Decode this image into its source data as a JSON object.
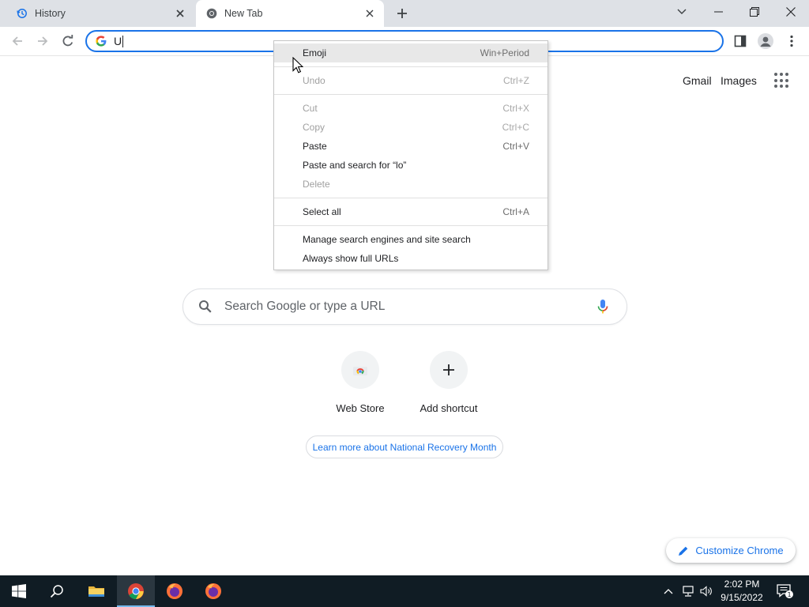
{
  "tabs": [
    {
      "title": "History",
      "icon": "history-icon"
    },
    {
      "title": "New Tab",
      "icon": "chrome-icon"
    }
  ],
  "omnibox": {
    "text": "U"
  },
  "ntp": {
    "links": {
      "gmail": "Gmail",
      "images": "Images"
    },
    "search_placeholder": "Search Google or type a URL",
    "shortcuts": [
      {
        "label": "Web Store",
        "icon": "web-store-icon"
      },
      {
        "label": "Add shortcut",
        "icon": "plus-icon"
      }
    ],
    "promo": "Learn more about National Recovery Month",
    "customize": "Customize Chrome"
  },
  "context_menu": {
    "groups": [
      [
        {
          "label": "Emoji",
          "shortcut": "Win+Period",
          "enabled": true,
          "highlighted": true
        }
      ],
      [
        {
          "label": "Undo",
          "shortcut": "Ctrl+Z",
          "enabled": false
        }
      ],
      [
        {
          "label": "Cut",
          "shortcut": "Ctrl+X",
          "enabled": false
        },
        {
          "label": "Copy",
          "shortcut": "Ctrl+C",
          "enabled": false
        },
        {
          "label": "Paste",
          "shortcut": "Ctrl+V",
          "enabled": true
        },
        {
          "label": "Paste and search for “lo”",
          "shortcut": "",
          "enabled": true
        },
        {
          "label": "Delete",
          "shortcut": "",
          "enabled": false
        }
      ],
      [
        {
          "label": "Select all",
          "shortcut": "Ctrl+A",
          "enabled": true
        }
      ],
      [
        {
          "label": "Manage search engines and site search",
          "shortcut": "",
          "enabled": true
        },
        {
          "label": "Always show full URLs",
          "shortcut": "",
          "enabled": true
        }
      ]
    ]
  },
  "taskbar": {
    "time": "2:02 PM",
    "date": "9/15/2022",
    "notification_count": "1",
    "apps": [
      "start-icon",
      "search-icon",
      "file-explorer-icon",
      "chrome-icon",
      "firefox-icon",
      "firefox-icon"
    ]
  },
  "colors": {
    "accent": "#1a73e8",
    "tabstrip": "#dee1e6",
    "taskbar": "#101c24"
  }
}
